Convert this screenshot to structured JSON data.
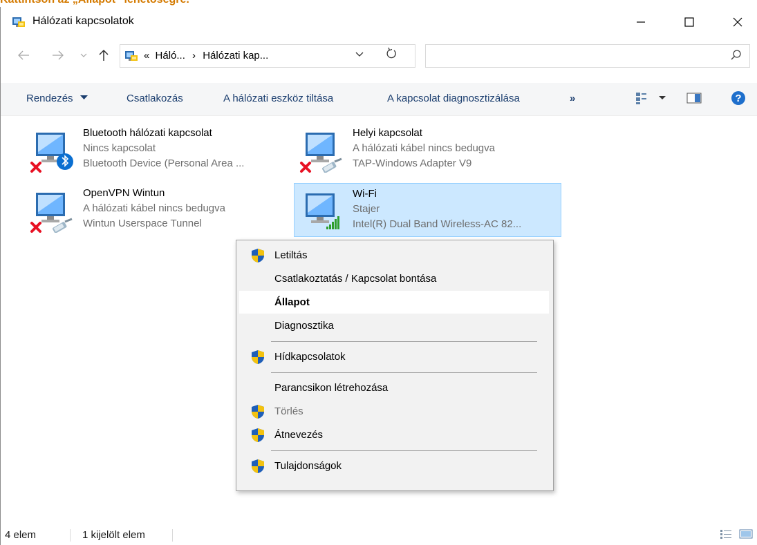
{
  "top_caption": "Kattintson az „Állapot” lehetőségre.",
  "window": {
    "title": "Hálózati kapcsolatok"
  },
  "address": {
    "crumb_prefix": "«",
    "crumb1": "Háló...",
    "crumb_sep": "›",
    "crumb2": "Hálózati kap...",
    "search_placeholder": ""
  },
  "toolbar": {
    "organize": "Rendezés",
    "connect": "Csatlakozás",
    "disable": "A hálózati eszköz tiltása",
    "diagnose": "A kapcsolat diagnosztizálása",
    "more": "»"
  },
  "connections": [
    {
      "name": "Bluetooth hálózati kapcsolat",
      "status": "Nincs kapcsolat",
      "device": "Bluetooth Device (Personal Area ...",
      "badge": "bluetooth-icon",
      "error": true
    },
    {
      "name": "Helyi kapcsolat",
      "status": "A hálózati kábel nincs bedugva",
      "device": "TAP-Windows Adapter V9",
      "badge": "cable-icon",
      "error": true
    },
    {
      "name": "OpenVPN Wintun",
      "status": "A hálózati kábel nincs bedugva",
      "device": "Wintun Userspace Tunnel",
      "badge": "cable-icon",
      "error": true
    },
    {
      "name": "Wi-Fi",
      "status": "Stajer",
      "device": "Intel(R) Dual Band Wireless-AC 82...",
      "badge": "wifi-signal-icon",
      "error": false,
      "selected": true
    }
  ],
  "context_menu": {
    "disable": "Letiltás",
    "connect_disconnect": "Csatlakoztatás / Kapcsolat bontása",
    "status": "Állapot",
    "diagnostics": "Diagnosztika",
    "bridge": "Hídkapcsolatok",
    "shortcut": "Parancsikon létrehozása",
    "delete": "Törlés",
    "rename": "Átnevezés",
    "properties": "Tulajdonságok"
  },
  "statusbar": {
    "count": "4 elem",
    "selected": "1 kijelölt elem"
  },
  "colors": {
    "accent": "#0078d7",
    "selection": "#cce8ff",
    "error_red": "#e81123",
    "link_blue": "#1a3d6e",
    "help_blue": "#1e6fcc"
  }
}
